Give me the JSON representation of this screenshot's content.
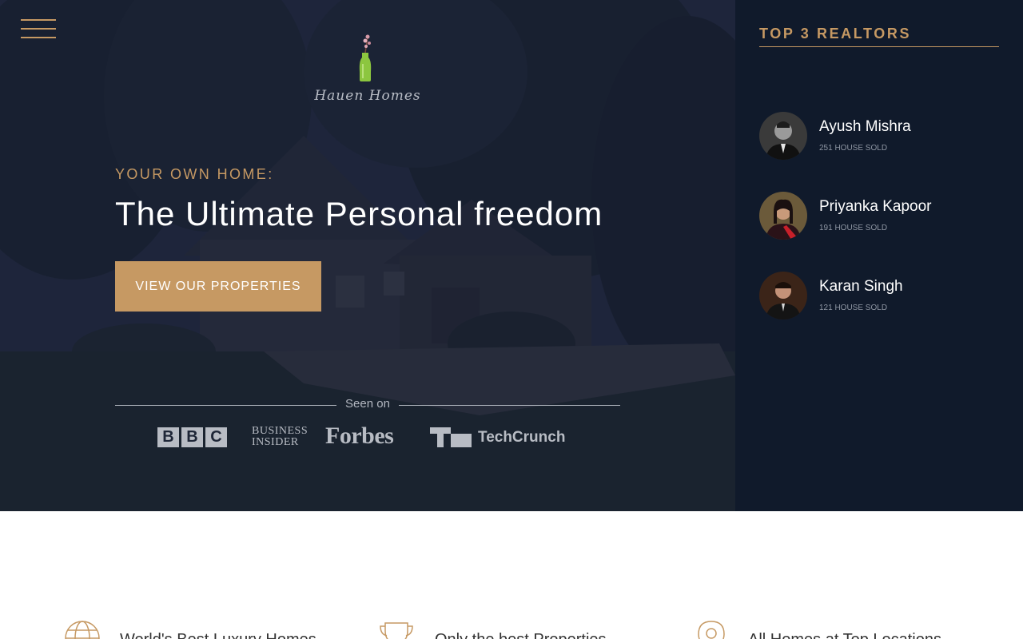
{
  "header": {
    "menu_icon": "hamburger-menu-icon",
    "logo_text": "Hauen Homes",
    "logo_icon": "flower-vase-icon"
  },
  "hero": {
    "eyebrow": "YOUR OWN HOME:",
    "headline": "The Ultimate Personal freedom",
    "cta_label": "VIEW OUR PROPERTIES",
    "seen_on_label": "Seen on",
    "press": [
      "BBC",
      "Business Insider",
      "Forbes",
      "TechCrunch"
    ]
  },
  "sidebar": {
    "title": "TOP 3 REALTORS",
    "realtors": [
      {
        "name": "Ayush Mishra",
        "sold": "251 HOUSE SOLD"
      },
      {
        "name": "Priyanka Kapoor",
        "sold": "191 HOUSE SOLD"
      },
      {
        "name": "Karan Singh",
        "sold": "121 HOUSE SOLD"
      }
    ]
  },
  "features": [
    {
      "icon": "globe-icon",
      "text": "World's Best Luxury Homes"
    },
    {
      "icon": "trophy-icon",
      "text": "Only the best Properties"
    },
    {
      "icon": "map-pin-icon",
      "text": "All Homes at Top Locations"
    }
  ],
  "colors": {
    "accent": "#c69963",
    "sidebar_bg": "#101a2b",
    "hero_overlay": "#1e2637"
  }
}
